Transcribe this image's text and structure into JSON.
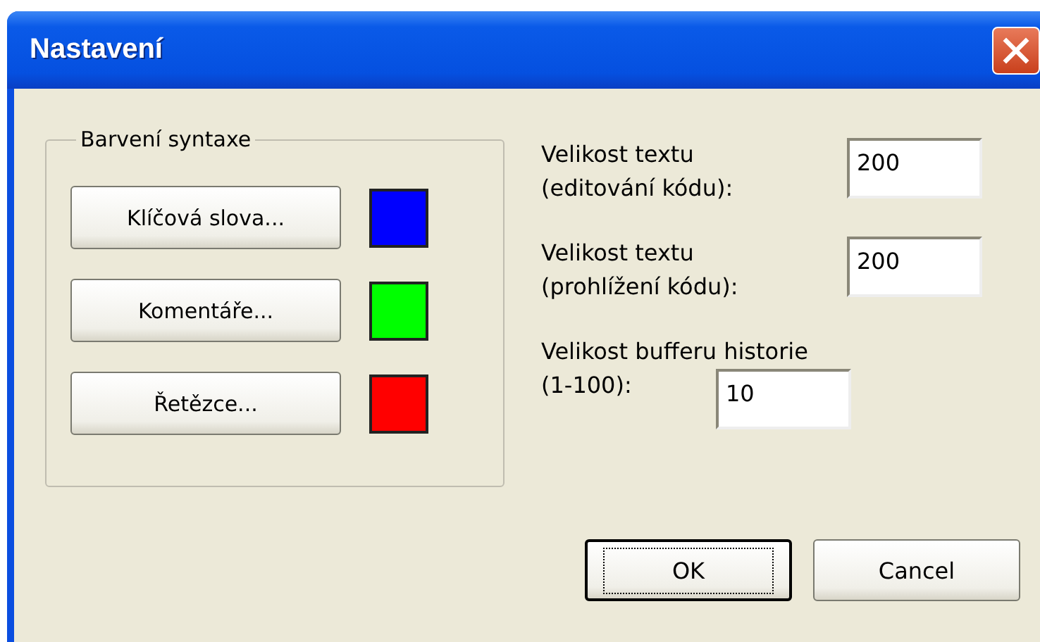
{
  "window": {
    "title": "Nastavení"
  },
  "syntax_group": {
    "title": "Barvení syntaxe",
    "items": [
      {
        "label": "Klíčová slova...",
        "color": "#0000ff"
      },
      {
        "label": "Komentáře...",
        "color": "#00ff00"
      },
      {
        "label": "Řetězce...",
        "color": "#ff0000"
      }
    ]
  },
  "fields": [
    {
      "kind": "side",
      "label_lines": [
        "Velikost textu",
        "(editování kódu):"
      ],
      "value": "200"
    },
    {
      "kind": "side",
      "label_lines": [
        "Velikost textu",
        "(prohlížení kódu):"
      ],
      "value": "200"
    },
    {
      "kind": "stacked",
      "label_lines": [
        "Velikost bufferu historie",
        "(1-100):"
      ],
      "value": "10"
    }
  ],
  "buttons": [
    {
      "label": "OK",
      "default": true
    },
    {
      "label": "Cancel",
      "default": false
    }
  ]
}
